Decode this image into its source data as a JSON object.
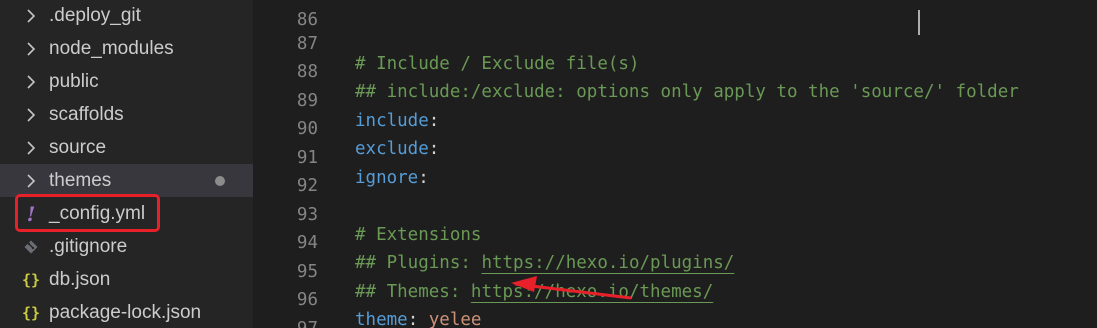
{
  "explorer": {
    "items": [
      {
        "label": ".deploy_git",
        "icon": "chevron-right-icon"
      },
      {
        "label": "node_modules",
        "icon": "chevron-right-icon"
      },
      {
        "label": "public",
        "icon": "chevron-right-icon"
      },
      {
        "label": "scaffolds",
        "icon": "chevron-right-icon"
      },
      {
        "label": "source",
        "icon": "chevron-right-icon"
      },
      {
        "label": "themes",
        "icon": "chevron-right-icon",
        "modified": true
      },
      {
        "label": "_config.yml",
        "icon": "yaml-file-icon",
        "glyph": "!"
      },
      {
        "label": ".gitignore",
        "icon": "git-file-icon",
        "glyph": "◆"
      },
      {
        "label": "db.json",
        "icon": "json-file-icon",
        "glyph": "{}"
      },
      {
        "label": "package-lock.json",
        "icon": "json-file-icon",
        "glyph": "{}"
      }
    ]
  },
  "editor": {
    "lines": [
      {
        "num": "86"
      },
      {
        "num": "87",
        "text": "# Include / Exclude file(s)"
      },
      {
        "num": "88",
        "text": "## include:/exclude: options only apply to the 'source/' folder"
      },
      {
        "num": "89",
        "key": "include",
        "punct": ":"
      },
      {
        "num": "90",
        "key": "exclude",
        "punct": ":"
      },
      {
        "num": "91",
        "key": "ignore",
        "punct": ":"
      },
      {
        "num": "92"
      },
      {
        "num": "93",
        "text": "# Extensions"
      },
      {
        "num": "94",
        "prefix": "## Plugins: ",
        "link": "https://hexo.io/plugins/"
      },
      {
        "num": "95",
        "prefix": "## Themes: ",
        "link": "https://hexo.io/themes/"
      },
      {
        "num": "96",
        "key": "theme",
        "punct": ": ",
        "value": "yelee"
      },
      {
        "num": "97"
      }
    ]
  },
  "colors": {
    "annotation": "#e8202a",
    "comment": "#6a9955",
    "key": "#569cd6",
    "string": "#ce9178"
  }
}
